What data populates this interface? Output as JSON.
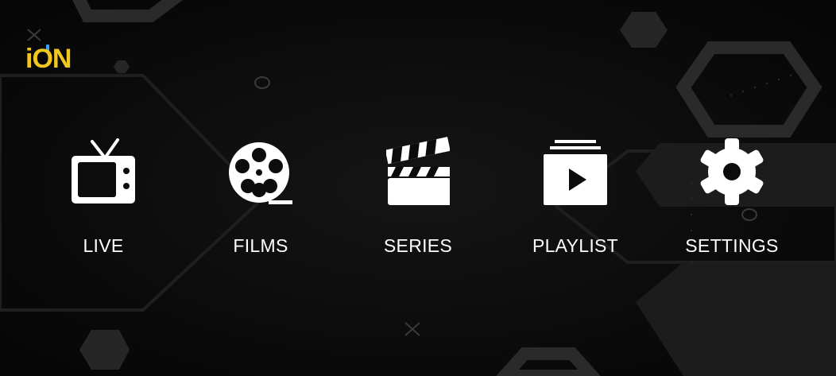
{
  "app": {
    "logo_text": "iON",
    "brand_color": "#f2c81e"
  },
  "menu": {
    "items": [
      {
        "label": "LIVE",
        "icon": "tv-icon"
      },
      {
        "label": "FILMS",
        "icon": "film-reel-icon"
      },
      {
        "label": "SERIES",
        "icon": "clapperboard-icon"
      },
      {
        "label": "PLAYLIST",
        "icon": "playlist-icon"
      },
      {
        "label": "SETTINGS",
        "icon": "gear-icon"
      }
    ]
  },
  "colors": {
    "background": "#0a0a0a",
    "text": "#ffffff",
    "accent": "#f2c81e"
  }
}
